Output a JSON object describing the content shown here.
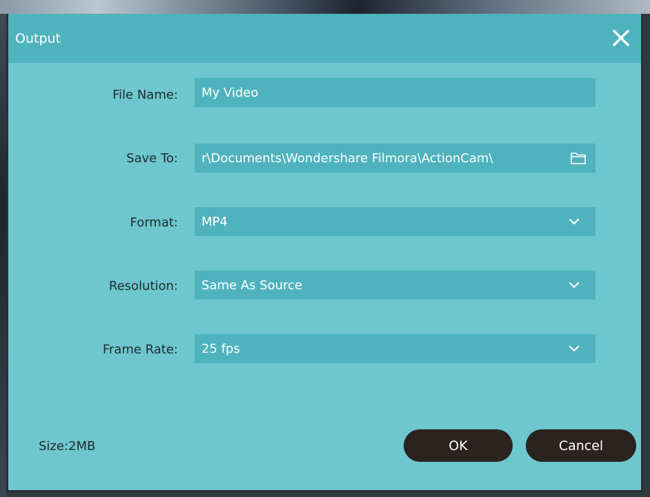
{
  "dialog": {
    "title": "Output",
    "close_icon": "close-icon"
  },
  "fields": {
    "file_name": {
      "label": "File Name:",
      "value": "My Video"
    },
    "save_to": {
      "label": "Save To:",
      "value": "r\\Documents\\Wondershare Filmora\\ActionCam\\",
      "icon": "folder-icon"
    },
    "format": {
      "label": "Format:",
      "value": "MP4",
      "icon": "chevron-down-icon"
    },
    "resolution": {
      "label": "Resolution:",
      "value": "Same As Source",
      "icon": "chevron-down-icon"
    },
    "frame_rate": {
      "label": "Frame Rate:",
      "value": "25 fps",
      "icon": "chevron-down-icon"
    }
  },
  "footer": {
    "size": "Size:2MB",
    "ok_label": "OK",
    "cancel_label": "Cancel"
  },
  "colors": {
    "dialog_bg": "#6ec6ce",
    "field_bg": "#4fb3be",
    "button_bg": "#2b2320"
  }
}
